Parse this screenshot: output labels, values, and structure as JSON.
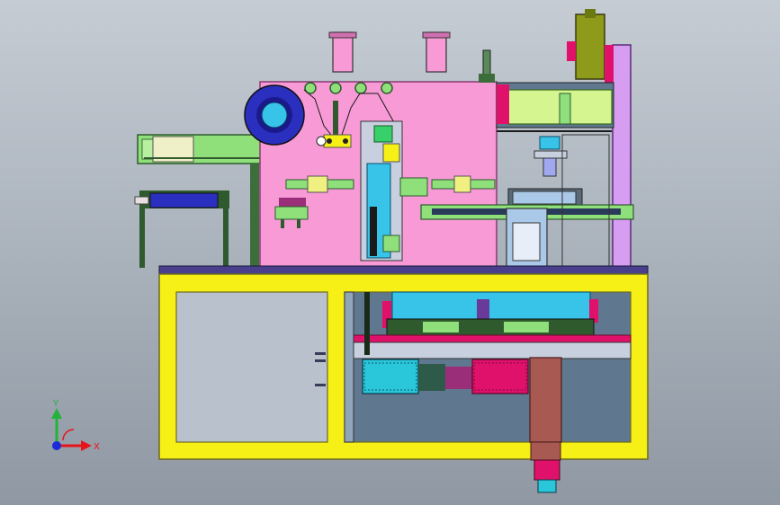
{
  "viewport": {
    "background_top": "#c5ccd4",
    "background_bottom": "#8f98a3"
  },
  "triad": {
    "x_label": "X",
    "y_label": "Y",
    "x_color": "#e8141c",
    "y_color": "#22b33a",
    "z_color": "#1a2bd8"
  },
  "colors": {
    "frame": "#f7f016",
    "frame_outline": "#6b6b20",
    "top_plate": "#4a3f8c",
    "main_panel": "#f79ad6",
    "drive_panel": "#5f7890",
    "roll": "#2b2fbf",
    "cyan_block": "#38c4e8",
    "green_part": "#8fe07a",
    "lavender_column": "#d79df0",
    "olive_cylinder": "#8e9a1a",
    "motor_cyan": "#29c7d9",
    "motor_magenta": "#e0116b",
    "brown_block": "#a85a52",
    "dark_green": "#2e5a2e",
    "light_blue": "#aac8e8"
  }
}
